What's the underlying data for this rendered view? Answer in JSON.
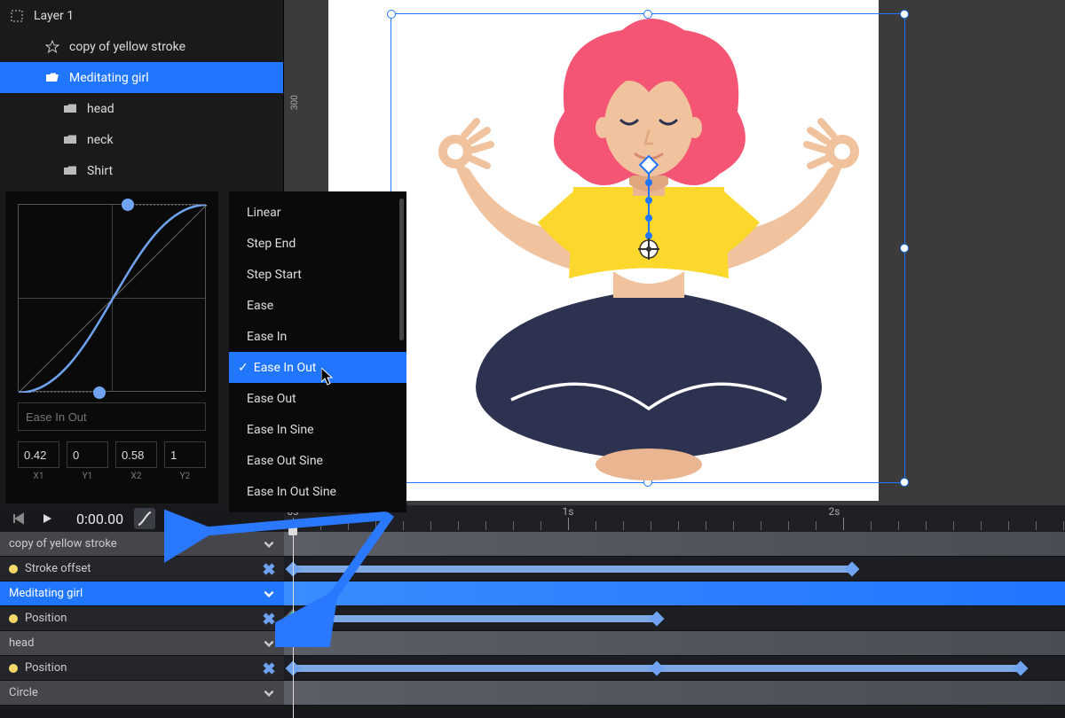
{
  "layers": {
    "root": "Layer 1",
    "items": [
      {
        "label": "copy of yellow stroke",
        "icon": "star"
      },
      {
        "label": "Meditating girl",
        "icon": "folder-open",
        "selected": true
      },
      {
        "label": "head",
        "icon": "folder"
      },
      {
        "label": "neck",
        "icon": "folder"
      },
      {
        "label": "Shirt",
        "icon": "folder"
      }
    ]
  },
  "ruler": {
    "v_mark": "300"
  },
  "easing": {
    "name_placeholder": "Ease In Out",
    "bezier": {
      "x1": "0.42",
      "y1": "0",
      "x2": "0.58",
      "y2": "1"
    },
    "bezier_labels": {
      "x1": "X1",
      "y1": "Y1",
      "x2": "X2",
      "y2": "Y2"
    },
    "options": [
      "Linear",
      "Step End",
      "Step Start",
      "Ease",
      "Ease In",
      "Ease In Out",
      "Ease Out",
      "Ease In Sine",
      "Ease Out Sine",
      "Ease In Out Sine"
    ],
    "selected": "Ease In Out"
  },
  "timeline": {
    "time": "0:00.00",
    "ruler_marks": [
      "0s",
      "1s",
      "2s"
    ],
    "tracks": [
      {
        "type": "group",
        "label": "copy of yellow stroke"
      },
      {
        "type": "prop",
        "label": "Stroke offset",
        "bar": [
          10,
          640
        ],
        "keys": [
          10,
          640
        ]
      },
      {
        "type": "group",
        "label": "Meditating girl",
        "selected": true
      },
      {
        "type": "prop",
        "label": "Position",
        "bar": [
          10,
          420
        ],
        "keys": [
          10,
          420
        ],
        "first_key_cyan": true
      },
      {
        "type": "group",
        "label": "head"
      },
      {
        "type": "prop",
        "label": "Position",
        "bar": [
          10,
          830
        ],
        "keys": [
          10,
          420,
          830
        ]
      },
      {
        "type": "group",
        "label": "Circle"
      }
    ]
  }
}
